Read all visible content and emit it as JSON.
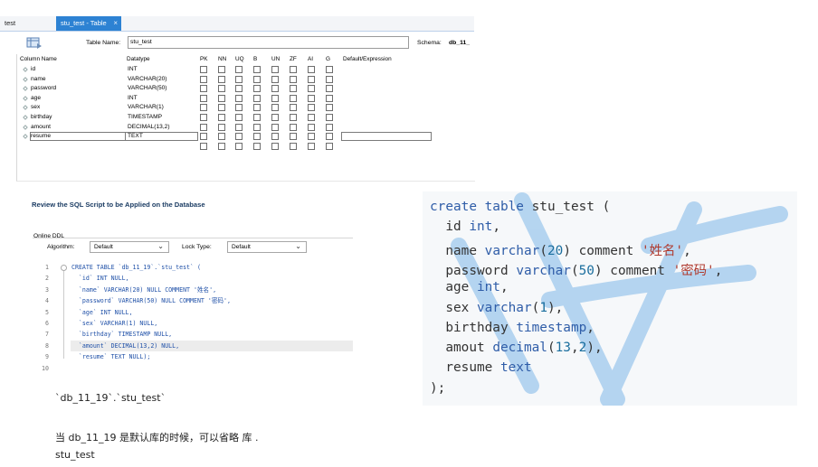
{
  "tabs": [
    {
      "label": "test"
    },
    {
      "label": "stu_test - Table",
      "close": "×"
    }
  ],
  "editor": {
    "table_name_label": "Table Name:",
    "table_name_value": "stu_test",
    "schema_label": "Schema:",
    "schema_value": "db_11_",
    "headers": [
      "Column Name",
      "Datatype",
      "PK",
      "NN",
      "UQ",
      "B",
      "UN",
      "ZF",
      "AI",
      "G",
      "Default/Expression"
    ],
    "columns": [
      {
        "name": "id",
        "type": "INT"
      },
      {
        "name": "name",
        "type": "VARCHAR(20)"
      },
      {
        "name": "password",
        "type": "VARCHAR(50)"
      },
      {
        "name": "age",
        "type": "INT"
      },
      {
        "name": "sex",
        "type": "VARCHAR(1)"
      },
      {
        "name": "birthday",
        "type": "TIMESTAMP"
      },
      {
        "name": "amount",
        "type": "DECIMAL(13,2)"
      },
      {
        "name": "resume",
        "type": "TEXT"
      },
      {
        "name": "",
        "type": ""
      }
    ]
  },
  "review": {
    "title": "Review the SQL Script to be Applied on the Database",
    "online_ddl": "Online DDL",
    "algorithm_label": "Algorithm:",
    "algorithm_value": "Default",
    "lock_type_label": "Lock Type:",
    "lock_type_value": "Default",
    "lines": [
      {
        "n": "1",
        "text": "CREATE TABLE `db_11_19`.`stu_test` ("
      },
      {
        "n": "2",
        "text": "  `id` INT NULL,"
      },
      {
        "n": "3",
        "text": "  `name` VARCHAR(20) NULL COMMENT '姓名',"
      },
      {
        "n": "4",
        "text": "  `password` VARCHAR(50) NULL COMMENT '密码',"
      },
      {
        "n": "5",
        "text": "  `age` INT NULL,"
      },
      {
        "n": "6",
        "text": "  `sex` VARCHAR(1) NULL,"
      },
      {
        "n": "7",
        "text": "  `birthday` TIMESTAMP NULL,"
      },
      {
        "n": "8",
        "text": "  `amount` DECIMAL(13,2) NULL,"
      },
      {
        "n": "9",
        "text": "  `resume` TEXT NULL);"
      },
      {
        "n": "10",
        "text": ""
      }
    ]
  },
  "notes": {
    "qualified_name": "`db_11_19`.`stu_test`",
    "explanation": "当 db_11_19 是默认库的时候，可以省略 库 .",
    "short_name": "stu_test"
  },
  "code_panel": {
    "lines": [
      [
        {
          "t": "create table ",
          "c": "kw"
        },
        {
          "t": "stu_test (",
          "c": ""
        }
      ],
      [
        {
          "t": "  id ",
          "c": ""
        },
        {
          "t": "int",
          "c": "kw"
        },
        {
          "t": ",",
          "c": ""
        }
      ],
      [
        {
          "t": "  name ",
          "c": ""
        },
        {
          "t": "varchar",
          "c": "kw"
        },
        {
          "t": "(",
          "c": ""
        },
        {
          "t": "20",
          "c": "num"
        },
        {
          "t": ") comment ",
          "c": ""
        },
        {
          "t": "'姓名'",
          "c": "str2"
        },
        {
          "t": ",",
          "c": ""
        }
      ],
      [
        {
          "t": "  password ",
          "c": ""
        },
        {
          "t": "varchar",
          "c": "kw"
        },
        {
          "t": "(",
          "c": ""
        },
        {
          "t": "50",
          "c": "num"
        },
        {
          "t": ") comment ",
          "c": ""
        },
        {
          "t": "'密码'",
          "c": "str2"
        },
        {
          "t": ",",
          "c": ""
        }
      ],
      [
        {
          "t": "  age ",
          "c": ""
        },
        {
          "t": "int",
          "c": "kw"
        },
        {
          "t": ",",
          "c": ""
        }
      ],
      [
        {
          "t": "  sex ",
          "c": ""
        },
        {
          "t": "varchar",
          "c": "kw"
        },
        {
          "t": "(",
          "c": ""
        },
        {
          "t": "1",
          "c": "num"
        },
        {
          "t": "),",
          "c": ""
        }
      ],
      [
        {
          "t": "  birthday ",
          "c": ""
        },
        {
          "t": "timestamp",
          "c": "kw"
        },
        {
          "t": ",",
          "c": ""
        }
      ],
      [
        {
          "t": "  amout ",
          "c": ""
        },
        {
          "t": "decimal",
          "c": "kw"
        },
        {
          "t": "(",
          "c": ""
        },
        {
          "t": "13",
          "c": "num"
        },
        {
          "t": ",",
          "c": ""
        },
        {
          "t": "2",
          "c": "num"
        },
        {
          "t": "),",
          "c": ""
        }
      ],
      [
        {
          "t": "  resume ",
          "c": ""
        },
        {
          "t": "text",
          "c": "kw"
        }
      ],
      [
        {
          "t": ");",
          "c": ""
        }
      ]
    ]
  },
  "colors": {
    "accent": "#2d82d3",
    "keyword": "#2f5da8",
    "string": "#b03a2e",
    "watermark": "#7fb8e8"
  }
}
